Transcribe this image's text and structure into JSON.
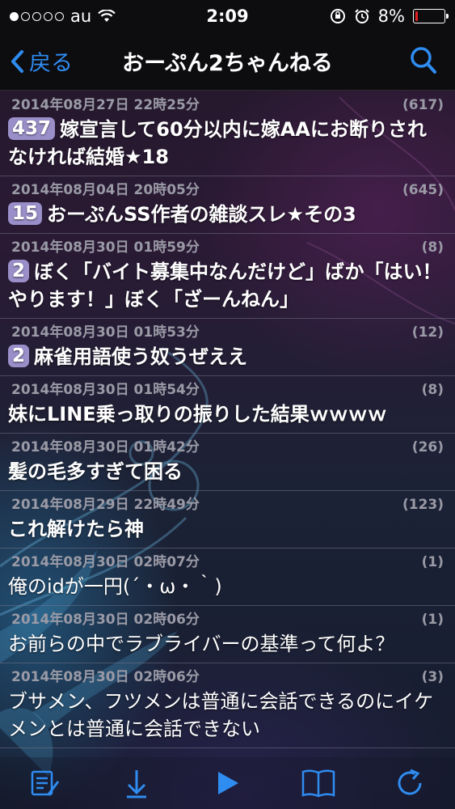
{
  "status_bar": {
    "carrier": "au",
    "time": "2:09",
    "battery_percent": "8%",
    "battery_level": 0.08,
    "signal_bars_filled": 1,
    "signal_bars_total": 5
  },
  "nav": {
    "back_label": "戻る",
    "title": "おーぷん2ちゃんねる",
    "accent_color": "#2f8cf0"
  },
  "threads": [
    {
      "date": "2014年08月27日 22時25分",
      "count": "(617)",
      "badge": "437",
      "title": "嫁宣言して60分以内に嫁AAにお断りされなければ結婚★18",
      "bold": true
    },
    {
      "date": "2014年08月04日 20時05分",
      "count": "(645)",
      "badge": "15",
      "title": "おーぷんSS作者の雑談スレ★その3",
      "bold": true
    },
    {
      "date": "2014年08月30日 01時59分",
      "count": "(8)",
      "badge": "2",
      "title": "ぼく「バイト募集中なんだけど」ばか「はい！やります！」ぼく「ざーんねん」",
      "bold": true
    },
    {
      "date": "2014年08月30日 01時53分",
      "count": "(12)",
      "badge": "2",
      "title": "麻雀用語使う奴うぜええ",
      "bold": true
    },
    {
      "date": "2014年08月30日 01時54分",
      "count": "(8)",
      "badge": "",
      "title": "妹にLINE乗っ取りの振りした結果ｗｗｗｗ",
      "bold": true
    },
    {
      "date": "2014年08月30日 01時42分",
      "count": "(26)",
      "badge": "",
      "title": "髪の毛多すぎて困る",
      "bold": true
    },
    {
      "date": "2014年08月29日 22時49分",
      "count": "(123)",
      "badge": "",
      "title": "これ解けたら神",
      "bold": true
    },
    {
      "date": "2014年08月30日 02時07分",
      "count": "(1)",
      "badge": "",
      "title": "俺のidが一円(´・ω・｀)",
      "bold": false
    },
    {
      "date": "2014年08月30日 02時06分",
      "count": "(1)",
      "badge": "",
      "title": "お前らの中でラブライバーの基準って何よ？",
      "bold": false
    },
    {
      "date": "2014年08月30日 02時06分",
      "count": "(3)",
      "badge": "",
      "title": "ブサメン、フツメンは普通に会話できるのにイケメンとは普通に会話できない",
      "bold": false
    }
  ],
  "toolbar": {
    "icons": [
      "edit-list-icon",
      "download-icon",
      "play-icon",
      "book-icon",
      "refresh-icon"
    ]
  }
}
